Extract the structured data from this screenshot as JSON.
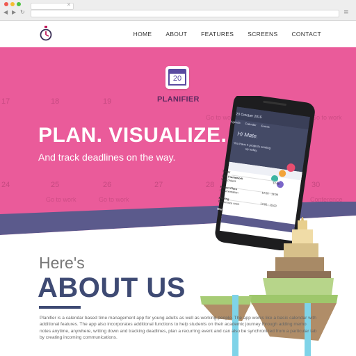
{
  "browser": {
    "menu_icon": "hamburger-icon",
    "back_icon": "back-icon",
    "forward_icon": "forward-icon",
    "reload_icon": "reload-icon"
  },
  "nav": {
    "logo_icon": "stopwatch-icon",
    "links": [
      "HOME",
      "ABOUT",
      "FEATURES",
      "SCREENS",
      "CONTACT"
    ]
  },
  "hero": {
    "app_icon_number": "20",
    "brand": "PLANIFIER",
    "headline": "PLAN. VISUALIZE.",
    "subline": "And track deadlines on the way.",
    "background_color": "#ea5b9a",
    "calendar_numbers": [
      "17",
      "18",
      "19",
      "24",
      "25",
      "26",
      "27",
      "28",
      "29",
      "30"
    ],
    "calendar_events": [
      "Go to work",
      "Go to work",
      "Go to work",
      "Go to work",
      "Conference"
    ]
  },
  "phone": {
    "date": "20 October 2015",
    "tabs": [
      "Agenda",
      "Calendar",
      "Events"
    ],
    "greeting": "Hi Mate.",
    "message": "You have 4 projects coming up today.",
    "list_header": "Today",
    "items": [
      {
        "title": "CSS Framework",
        "sub": "Web project",
        "time": "12:00"
      },
      {
        "title": "Project Flora",
        "sub": "Documentation",
        "time": "12:00 - 13:00"
      },
      {
        "title": "Meeting",
        "sub": "Conference room",
        "time": "14:00 - 15:00"
      },
      {
        "title": "Work on project",
        "sub": "",
        "time": "15:00 - 16:00"
      }
    ]
  },
  "about": {
    "small": "Here's",
    "big": "ABOUT US",
    "paragraph": "Planifier is a calendar based time management app for young adults as well as working people. The app works like a basic calendar with additional features. The app also incorporates additional functions to help students on their academic journey through adding memo notes anytime, anywhere, writing down and tracking deadlines, plan a recurring event and can also be synchronized from a particular tab by creating incoming communications.",
    "accent_color": "#3e4a73"
  }
}
